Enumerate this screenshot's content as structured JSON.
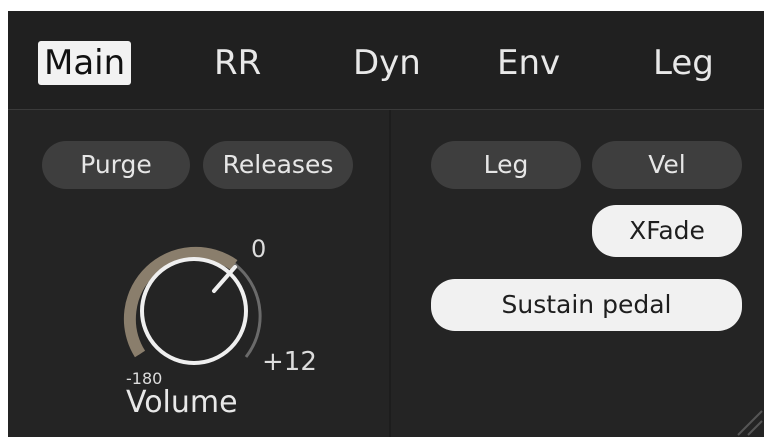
{
  "tabs": [
    {
      "label": "Main",
      "active": true
    },
    {
      "label": "RR",
      "active": false
    },
    {
      "label": "Dyn",
      "active": false
    },
    {
      "label": "Env",
      "active": false
    },
    {
      "label": "Leg",
      "active": false
    }
  ],
  "left": {
    "purge_label": "Purge",
    "releases_label": "Releases",
    "volume": {
      "label": "Volume",
      "min_label": "-180",
      "current_label": "0",
      "max_label": "+12"
    }
  },
  "right": {
    "leg_label": "Leg",
    "vel_label": "Vel",
    "xfade_label": "XFade",
    "sustain_label": "Sustain pedal"
  },
  "colors": {
    "panel": "#242424",
    "tabbar": "#202020",
    "pill_dark": "#3e3e3e",
    "pill_light": "#f1f1f1",
    "knob_arc": "#8a7e6c"
  }
}
